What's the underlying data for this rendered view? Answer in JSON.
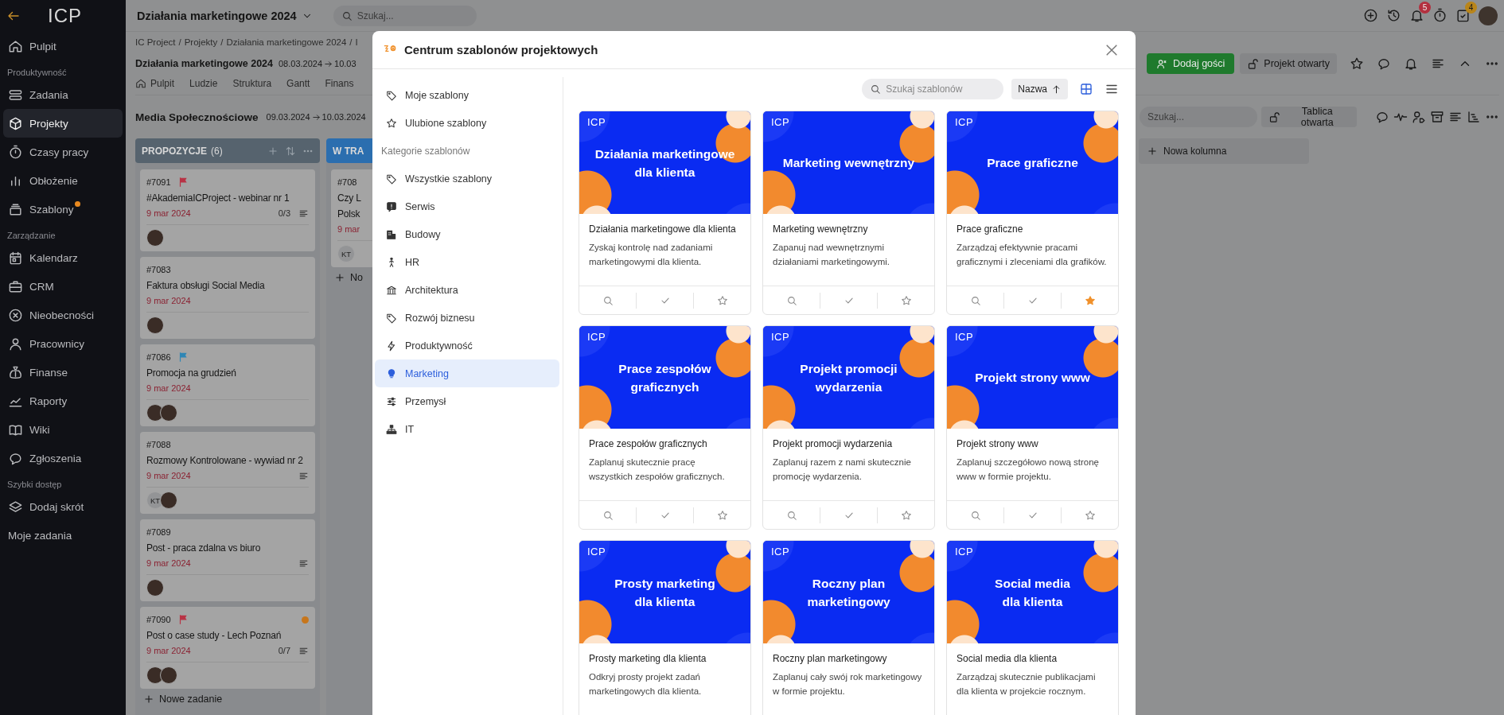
{
  "sidebar": {
    "logo": "ICP",
    "items": [
      {
        "kind": "link",
        "label": "Pulpit",
        "selected": false,
        "dot": false
      },
      {
        "kind": "section",
        "label": "Produktywność"
      },
      {
        "kind": "link",
        "label": "Zadania",
        "selected": false,
        "dot": false
      },
      {
        "kind": "link",
        "label": "Projekty",
        "selected": true,
        "dot": false
      },
      {
        "kind": "link",
        "label": "Czasy pracy",
        "selected": false,
        "dot": false
      },
      {
        "kind": "link",
        "label": "Obłożenie",
        "selected": false,
        "dot": false
      },
      {
        "kind": "link",
        "label": "Szablony",
        "selected": false,
        "dot": true
      },
      {
        "kind": "section",
        "label": "Zarządzanie"
      },
      {
        "kind": "link",
        "label": "Kalendarz",
        "selected": false,
        "dot": false
      },
      {
        "kind": "link",
        "label": "CRM",
        "selected": false,
        "dot": false
      },
      {
        "kind": "link",
        "label": "Nieobecności",
        "selected": false,
        "dot": false
      },
      {
        "kind": "link",
        "label": "Pracownicy",
        "selected": false,
        "dot": false
      },
      {
        "kind": "link",
        "label": "Finanse",
        "selected": false,
        "dot": false
      },
      {
        "kind": "link",
        "label": "Raporty",
        "selected": false,
        "dot": false
      },
      {
        "kind": "link",
        "label": "Wiki",
        "selected": false,
        "dot": false
      },
      {
        "kind": "link",
        "label": "Zgłoszenia",
        "selected": false,
        "dot": false
      },
      {
        "kind": "section",
        "label": "Szybki dostęp"
      },
      {
        "kind": "link",
        "label": "Dodaj skrót",
        "selected": false,
        "dot": false
      },
      {
        "kind": "plain",
        "label": "Moje zadania",
        "selected": false,
        "dot": false
      }
    ]
  },
  "topbar": {
    "project": "Działania marketingowe 2024",
    "search_placeholder": "Szukaj...",
    "notifications_badge": "5",
    "tasks_badge": "4"
  },
  "project": {
    "breadcrumb": [
      "IC Project",
      "Projekty",
      "Działania marketingowe 2024",
      "I"
    ],
    "separator": "/",
    "title": "Działania marketingowe 2024",
    "date_start": "08.03.2024",
    "date_end": "10.03",
    "tabs": [
      {
        "label": "Pulpit"
      },
      {
        "label": "Ludzie"
      },
      {
        "label": "Struktura"
      },
      {
        "label": "Gantt"
      },
      {
        "label": "Finans"
      }
    ],
    "guest_button": "Dodaj gości",
    "lock_button": "Projekt otwarty"
  },
  "board": {
    "title": "Media Społecznościowe",
    "date_start": "09.03.2024",
    "date_end": "10.03.2024",
    "search_placeholder": "Szukaj...",
    "lock_button": "Tablica otwarta",
    "new_column": "Nowa kolumna",
    "columns": [
      {
        "title": "PROPOZYCJE",
        "count": "(6)",
        "color": "#56636e",
        "add_label": "Nowe zadanie",
        "cards": [
          {
            "id": "#7091",
            "flag": {
              "color": "#b83345"
            },
            "title": "#AkademiaICProject - webinar nr 1",
            "date": "9 mar 2024",
            "checklist": "0/3",
            "description": true,
            "avatars": [
              {
                "kind": "photo"
              }
            ]
          },
          {
            "id": "#7083",
            "title": "Faktura obsługi Social Media",
            "date": "9 mar 2024",
            "description": false,
            "avatars": [
              {
                "kind": "photo"
              }
            ]
          },
          {
            "id": "#7086",
            "flag": {
              "color": "#2f86b5"
            },
            "title": "Promocja na grudzień",
            "date": "9 mar 2024",
            "description": false,
            "avatars": [
              {
                "kind": "photo"
              },
              {
                "kind": "photo"
              }
            ]
          },
          {
            "id": "#7088",
            "title": "Rozmowy Kontrolowane - wywiad nr 2",
            "date": "9 mar 2024",
            "description": true,
            "avatars": [
              {
                "kind": "initials",
                "text": "KT"
              },
              {
                "kind": "photo"
              }
            ]
          },
          {
            "id": "#7089",
            "title": "Post - praca zdalna vs biuro",
            "date": "9 mar 2024",
            "description": true,
            "avatars": [
              {
                "kind": "photo"
              }
            ]
          },
          {
            "id": "#7090",
            "flag": {
              "color": "#b83345"
            },
            "color": "#c7761c",
            "title": "Post o case study - Lech Poznań",
            "date": "9 mar 2024",
            "checklist": "0/7",
            "description": true,
            "avatars": [
              {
                "kind": "photo"
              },
              {
                "kind": "photo"
              }
            ]
          }
        ]
      },
      {
        "title": "W TRA",
        "color": "#2b6eaf",
        "add_label": "No",
        "cards": [
          {
            "id": "#708",
            "title": "Czy L\nPolsk",
            "date": "9 mar",
            "description": false,
            "avatars": [
              {
                "kind": "initials",
                "text": "KT"
              }
            ]
          }
        ]
      }
    ]
  },
  "modal": {
    "title": "Centrum szablonów projektowych",
    "search_placeholder": "Szukaj szablonów",
    "sort_label": "Nazwa",
    "views": [
      {
        "kind": "grid",
        "selected": true
      },
      {
        "kind": "list",
        "selected": false
      }
    ],
    "nav": [
      {
        "kind": "link",
        "label": "Moje szablony",
        "selected": false
      },
      {
        "kind": "link",
        "label": "Ulubione szablony",
        "selected": false
      },
      {
        "kind": "section",
        "label": "Kategorie szablonów"
      },
      {
        "kind": "link",
        "label": "Wszystkie szablony",
        "selected": false
      },
      {
        "kind": "link",
        "label": "Serwis",
        "selected": false
      },
      {
        "kind": "link",
        "label": "Budowy",
        "selected": false
      },
      {
        "kind": "link",
        "label": "HR",
        "selected": false
      },
      {
        "kind": "link",
        "label": "Architektura",
        "selected": false
      },
      {
        "kind": "link",
        "label": "Rozwój biznesu",
        "selected": false
      },
      {
        "kind": "link",
        "label": "Produktywność",
        "selected": false
      },
      {
        "kind": "link",
        "label": "Marketing",
        "selected": true
      },
      {
        "kind": "link",
        "label": "Przemysł",
        "selected": false
      },
      {
        "kind": "link",
        "label": "IT",
        "selected": false
      }
    ],
    "templates": [
      {
        "logo": "ICP",
        "banner": "Działania marketingowe\ndla klienta",
        "title": "Działania marketingowe dla klienta",
        "description": "Zyskaj kontrolę nad zadaniami marketingowymi dla klienta.",
        "favorite": false
      },
      {
        "logo": "ICP",
        "banner": "Marketing wewnętrzny",
        "title": "Marketing wewnętrzny",
        "description": "Zapanuj nad wewnętrznymi działaniami marketingowymi.",
        "favorite": false
      },
      {
        "logo": "ICP",
        "banner": "Prace graficzne",
        "title": "Prace graficzne",
        "description": "Zarządzaj efektywnie pracami graficznymi i zleceniami dla grafików.",
        "favorite": true
      },
      {
        "logo": "ICP",
        "banner": "Prace zespołów\ngraficznych",
        "title": "Prace zespołów graficznych",
        "description": "Zaplanuj skutecznie pracę wszystkich zespołów graficznych.",
        "favorite": false
      },
      {
        "logo": "ICP",
        "banner": "Projekt promocji\nwydarzenia",
        "title": "Projekt promocji wydarzenia",
        "description": "Zaplanuj razem z nami skutecznie promocję wydarzenia.",
        "favorite": false
      },
      {
        "logo": "ICP",
        "banner": "Projekt strony www",
        "title": "Projekt strony www",
        "description": "Zaplanuj szczegółowo nową stronę www w formie projektu.",
        "favorite": false
      },
      {
        "logo": "ICP",
        "banner": "Prosty marketing\ndla klienta",
        "title": "Prosty marketing dla klienta",
        "description": "Odkryj prosty projekt zadań marketingowych dla klienta."
      },
      {
        "logo": "ICP",
        "banner": "Roczny plan\nmarketingowy",
        "title": "Roczny plan marketingowy",
        "description": "Zaplanuj cały swój rok marketingowy w formie projektu."
      },
      {
        "logo": "ICP",
        "banner": "Social media\ndla klienta",
        "title": "Social media dla klienta",
        "description": "Zarządzaj skutecznie publikacjami dla klienta w projekcie rocznym."
      }
    ]
  }
}
